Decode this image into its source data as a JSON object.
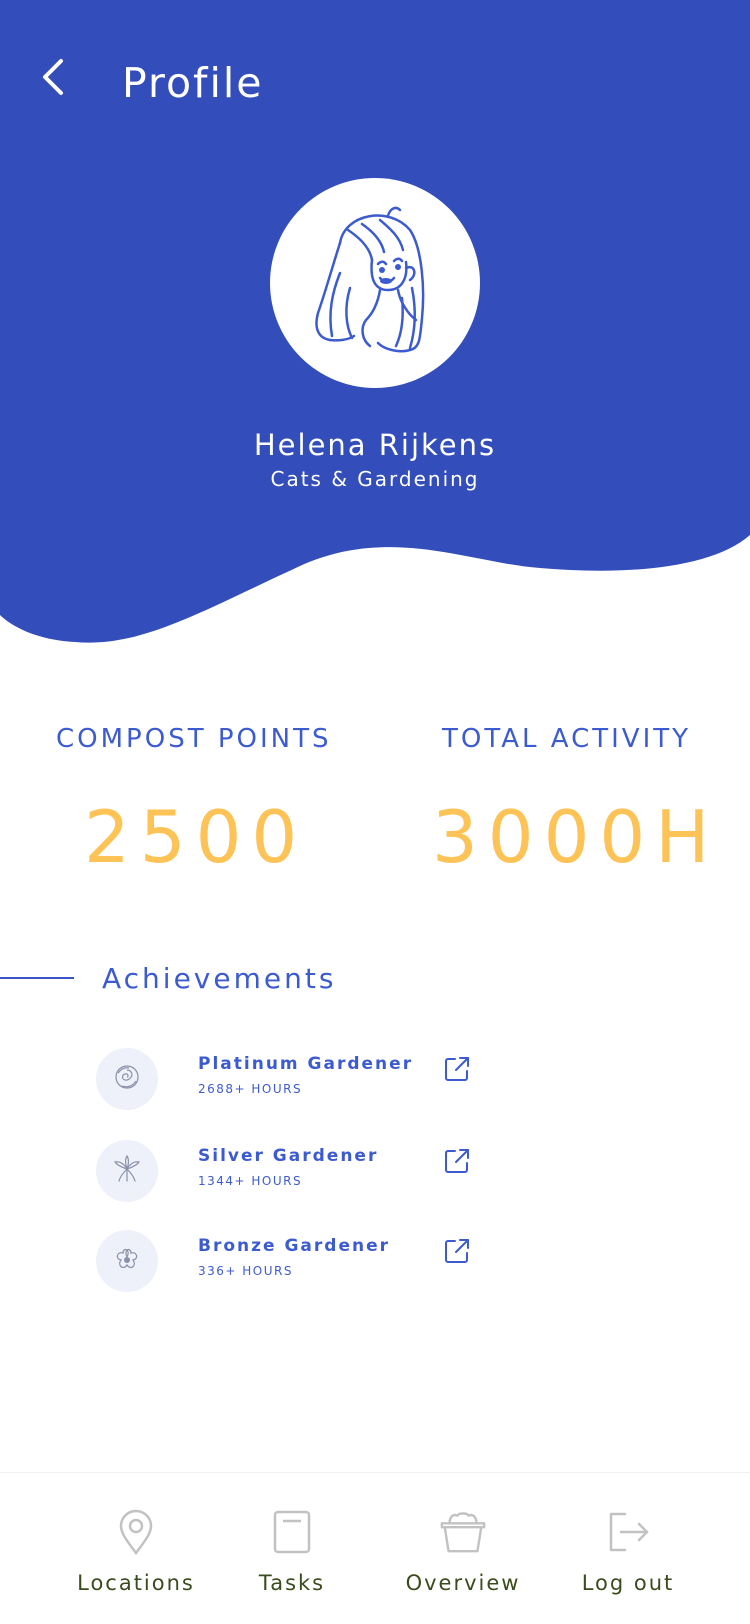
{
  "header": {
    "title": "Profile",
    "background_color": "#334ebb"
  },
  "profile": {
    "name": "Helena Rijkens",
    "tagline": "Cats & Gardening"
  },
  "stats": [
    {
      "label": "COMPOST POINTS",
      "value": "2500"
    },
    {
      "label": "TOTAL ACTIVITY",
      "value": "3000H"
    }
  ],
  "achievements": {
    "title": "Achievements",
    "items": [
      {
        "title": "Platinum Gardener",
        "subtitle": "2688+ HOURS",
        "icon": "rose-icon"
      },
      {
        "title": "Silver Gardener",
        "subtitle": "1344+ HOURS",
        "icon": "lily-icon"
      },
      {
        "title": "Bronze Gardener",
        "subtitle": "336+ HOURS",
        "icon": "blossom-icon"
      }
    ]
  },
  "bottom_nav": {
    "items": [
      {
        "label": "Locations",
        "icon": "location-pin-icon"
      },
      {
        "label": "Tasks",
        "icon": "document-icon"
      },
      {
        "label": "Overview",
        "icon": "basket-icon"
      },
      {
        "label": "Log out",
        "icon": "logout-icon"
      }
    ]
  },
  "colors": {
    "primary": "#334ebb",
    "accent_text": "#3d5bd0",
    "stat_value": "#fdc356",
    "nav_icon": "#c2c2c2",
    "nav_label": "#3a4b1d"
  }
}
